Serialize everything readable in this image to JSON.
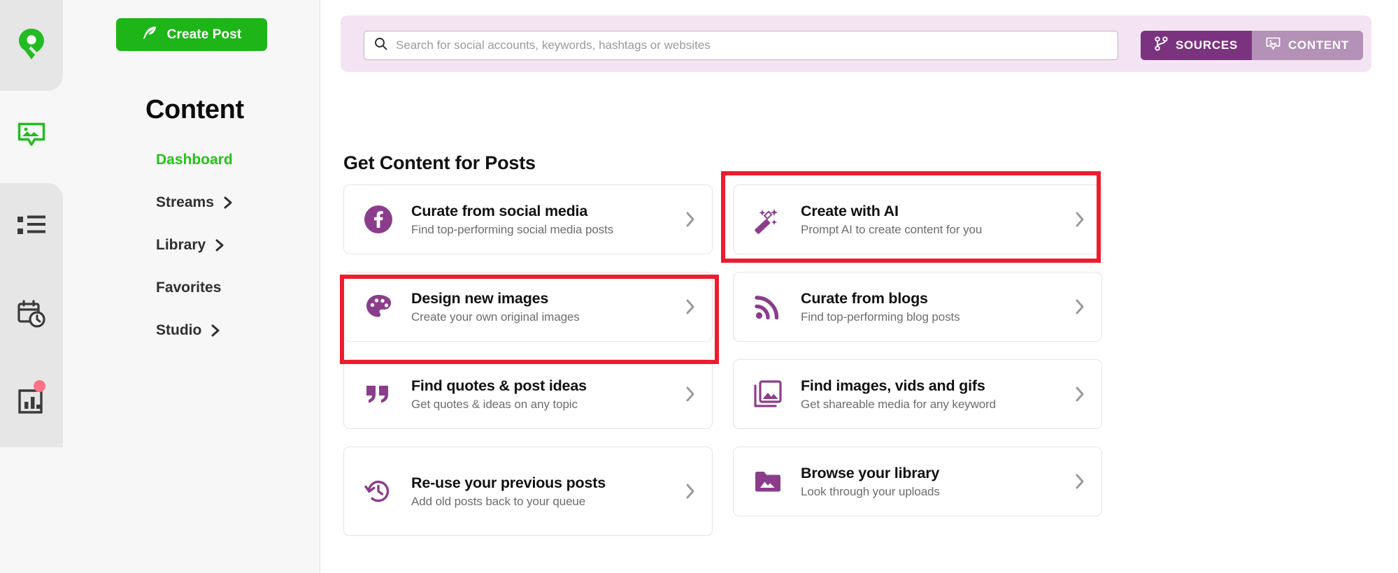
{
  "rail": {
    "items": [
      {
        "name": "brand-logo",
        "icon": "pin-logo-icon",
        "active": true
      },
      {
        "name": "content-nav",
        "icon": "image-comment-icon",
        "active": false
      },
      {
        "name": "queue-nav",
        "icon": "list-icon",
        "active": false
      },
      {
        "name": "calendar-nav",
        "icon": "calendar-clock-icon",
        "active": false
      },
      {
        "name": "analytics-nav",
        "icon": "bar-chart-icon",
        "active": false,
        "badge": true
      }
    ]
  },
  "sidebar": {
    "create_post_label": "Create Post",
    "title": "Content",
    "nav": [
      {
        "label": "Dashboard",
        "active": true,
        "chevron": false
      },
      {
        "label": "Streams",
        "active": false,
        "chevron": true
      },
      {
        "label": "Library",
        "active": false,
        "chevron": true
      },
      {
        "label": "Favorites",
        "active": false,
        "chevron": false
      },
      {
        "label": "Studio",
        "active": false,
        "chevron": true
      }
    ]
  },
  "search": {
    "placeholder": "Search for social accounts, keywords, hashtags or websites",
    "value": "",
    "icon": "search-icon"
  },
  "segmented": {
    "sources_label": "SOURCES",
    "content_label": "CONTENT",
    "active": "SOURCES",
    "sources_icon": "branch-icon",
    "content_icon": "image-comment-icon"
  },
  "main": {
    "section_title": "Get Content for Posts",
    "cards": [
      {
        "title": "Curate from social media",
        "subtitle": "Find top-performing social media posts",
        "icon": "facebook-icon",
        "column": "left",
        "highlighted": false,
        "tall": false
      },
      {
        "title": "Create with AI",
        "subtitle": "Prompt AI to create content for you",
        "icon": "magic-wand-icon",
        "column": "right",
        "highlighted": true,
        "tall": false
      },
      {
        "title": "Design new images",
        "subtitle": "Create your own original images",
        "icon": "palette-icon",
        "column": "left",
        "highlighted": true,
        "tall": false
      },
      {
        "title": "Curate from blogs",
        "subtitle": "Find top-performing blog posts",
        "icon": "rss-icon",
        "column": "right",
        "highlighted": false,
        "tall": false
      },
      {
        "title": "Find quotes & post ideas",
        "subtitle": "Get quotes & ideas on any topic",
        "icon": "quote-icon",
        "column": "left",
        "highlighted": false,
        "tall": false
      },
      {
        "title": "Find images, vids and gifs",
        "subtitle": "Get shareable media for any keyword",
        "icon": "stacked-images-icon",
        "column": "right",
        "highlighted": false,
        "tall": false
      },
      {
        "title": "Re-use your previous posts",
        "subtitle": "Add old posts back to your queue",
        "icon": "clock-rewind-icon",
        "column": "left",
        "highlighted": false,
        "tall": true
      },
      {
        "title": "Browse your library",
        "subtitle": "Look through your uploads",
        "icon": "folder-image-icon",
        "column": "right",
        "highlighted": false,
        "tall": false
      }
    ]
  },
  "colors": {
    "brand_green": "#1db518",
    "active_green": "#22c514",
    "purple_dark": "#7b3380",
    "purple_light": "#b491b7",
    "purple_icon": "#8b3d8b",
    "header_lavender": "#f4e4f3",
    "annotation_red": "#ed1c2e",
    "badge_red": "#fb7185",
    "sidebar_grey": "#f7f7f7"
  }
}
